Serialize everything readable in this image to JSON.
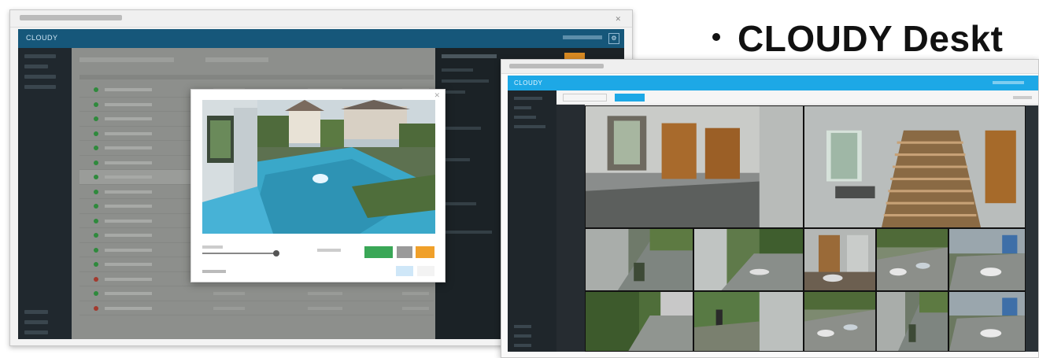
{
  "slide": {
    "title": "CLOUDY Deskt"
  },
  "window_left": {
    "app_name": "CLOUDY",
    "settings_icon": "gear-icon",
    "camera_list": {
      "status_colors": {
        "online": "#2f8a3c",
        "offline": "#a33a2e"
      },
      "rows": [
        {
          "status": "online"
        },
        {
          "status": "online"
        },
        {
          "status": "online"
        },
        {
          "status": "online"
        },
        {
          "status": "online"
        },
        {
          "status": "online"
        },
        {
          "status": "online",
          "selected": true
        },
        {
          "status": "online"
        },
        {
          "status": "online"
        },
        {
          "status": "online"
        },
        {
          "status": "online"
        },
        {
          "status": "online"
        },
        {
          "status": "online"
        },
        {
          "status": "offline"
        },
        {
          "status": "online"
        },
        {
          "status": "offline"
        }
      ]
    },
    "modal": {
      "close_icon": "close-icon",
      "buttons": {
        "green": "#3aa757",
        "grey": "#9a9a9a",
        "orange": "#f0a02a"
      }
    }
  },
  "window_right": {
    "app_name": "CLOUDY",
    "accent": "#1da8e6",
    "camera_grid": {
      "large_views": 2,
      "small_views": 10
    }
  }
}
